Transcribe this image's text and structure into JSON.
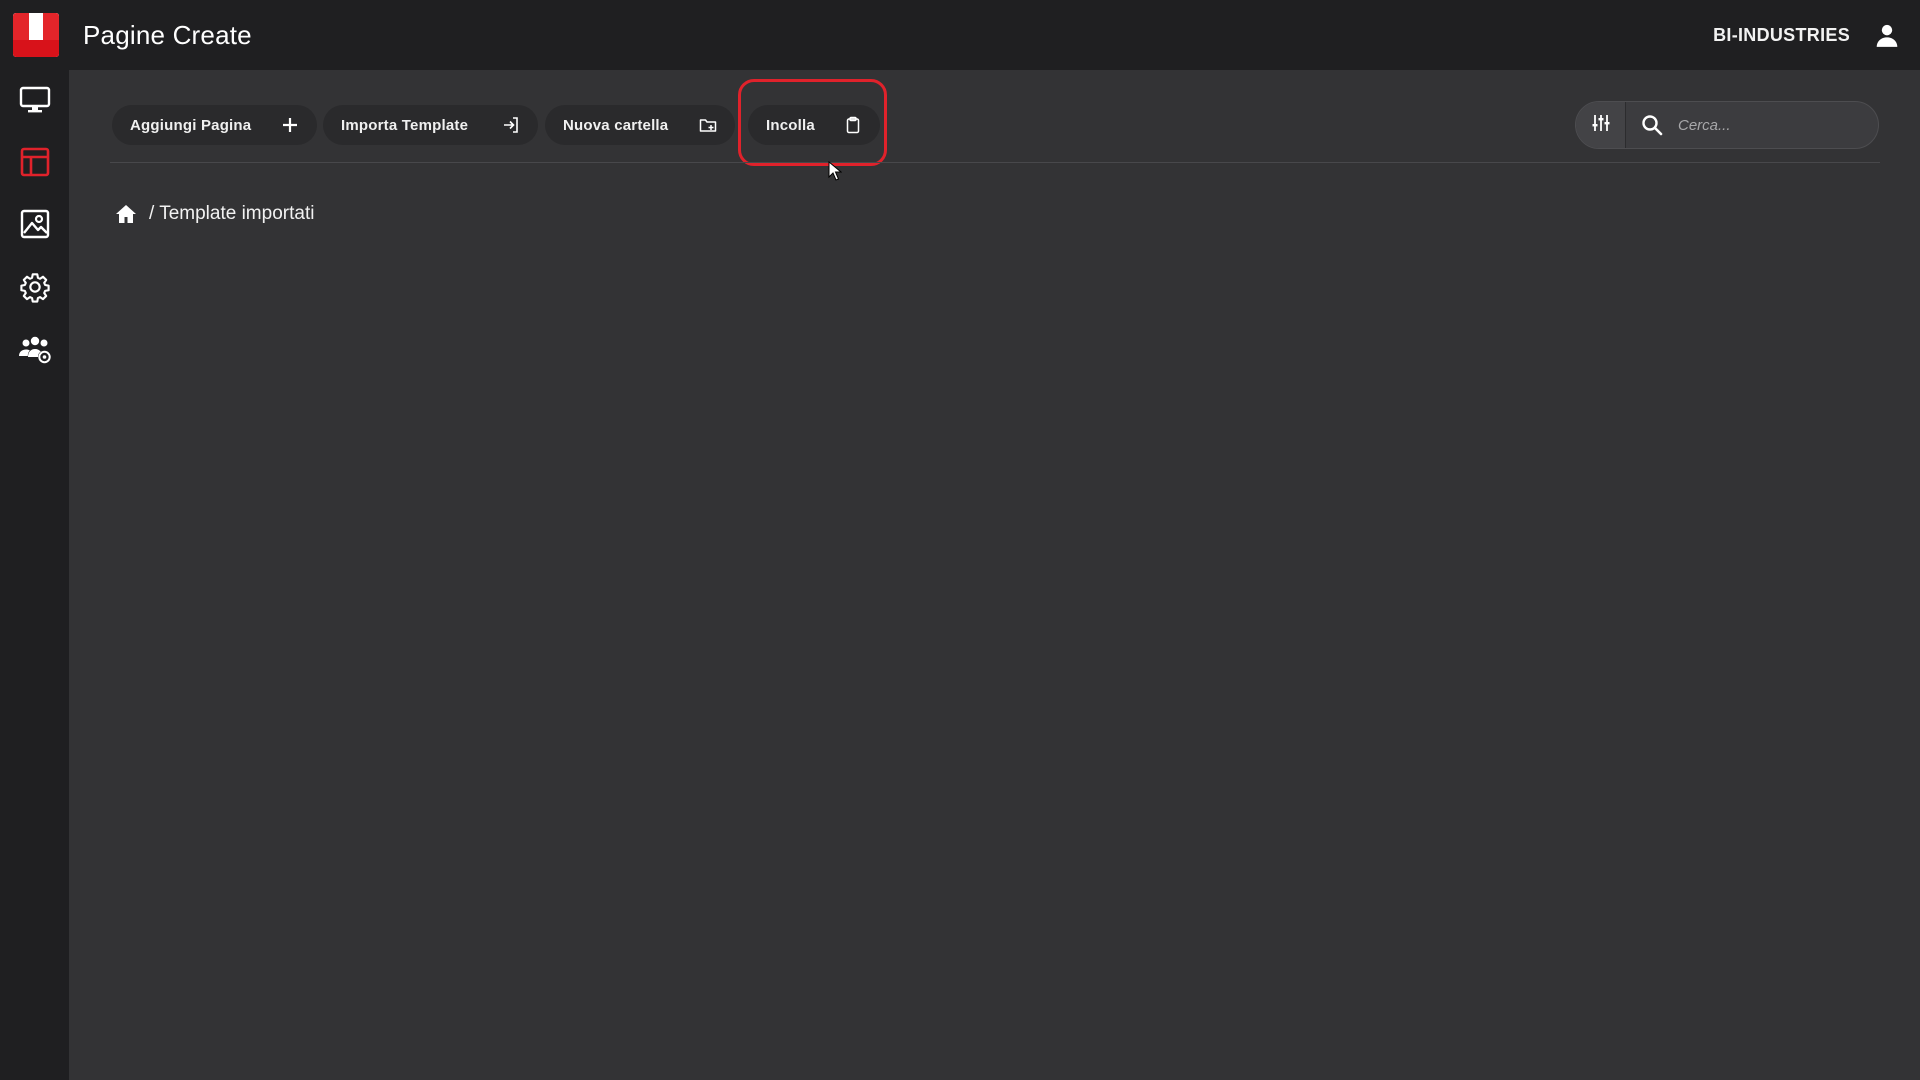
{
  "header": {
    "app_title": "Pagine Create",
    "org_name": "BI-INDUSTRIES",
    "user_icon": "user-icon",
    "logo_colors": {
      "red": "#e3252a",
      "white": "#ffffff"
    }
  },
  "sidebar": {
    "items": [
      {
        "icon": "monitor-icon",
        "active": false
      },
      {
        "icon": "layout-icon",
        "active": true
      },
      {
        "icon": "image-icon",
        "active": false
      },
      {
        "icon": "gear-icon",
        "active": false
      },
      {
        "icon": "users-gear-icon",
        "active": false
      }
    ],
    "active_color": "#e0222b"
  },
  "toolbar": {
    "add_page_label": "Aggiungi Pagina",
    "import_template_label": "Importa Template",
    "new_folder_label": "Nuova cartella",
    "paste_label": "Incolla",
    "highlight_color": "#e0222b"
  },
  "search": {
    "placeholder": "Cerca...",
    "value": ""
  },
  "breadcrumb": {
    "path": "/ Template importati"
  }
}
